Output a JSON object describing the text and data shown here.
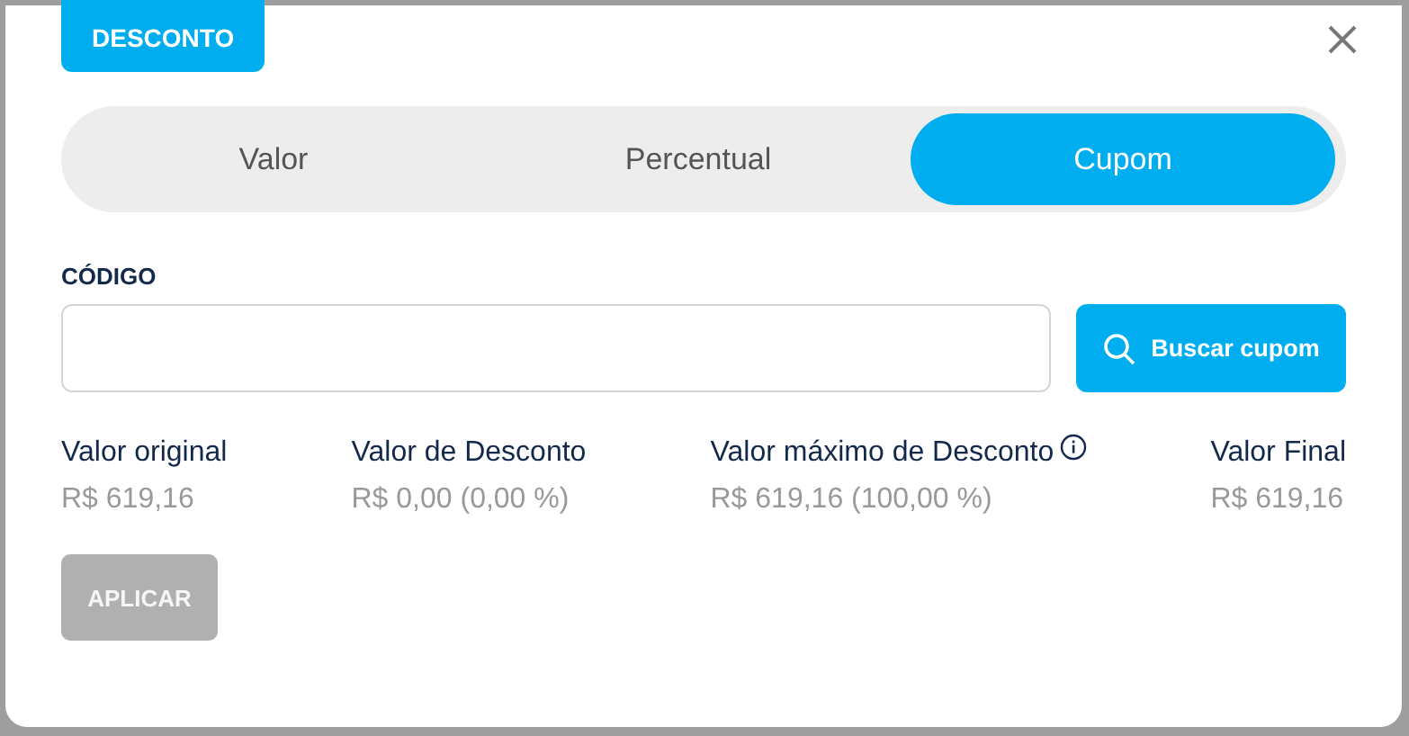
{
  "badge": "DESCONTO",
  "tabs": [
    {
      "label": "Valor",
      "selected": false
    },
    {
      "label": "Percentual",
      "selected": false
    },
    {
      "label": "Cupom",
      "selected": true
    }
  ],
  "code_field": {
    "label": "CÓDIGO"
  },
  "search_button": {
    "label": "Buscar cupom"
  },
  "summary": [
    {
      "label": "Valor original",
      "value": "R$ 619,16",
      "info": false
    },
    {
      "label": "Valor de Desconto",
      "value": "R$ 0,00 (0,00 %)",
      "info": false
    },
    {
      "label": "Valor máximo de Desconto",
      "value": "R$ 619,16 (100,00 %)",
      "info": true
    },
    {
      "label": "Valor Final",
      "value": "R$ 619,16",
      "info": false
    }
  ],
  "apply_button": {
    "label": "APLICAR",
    "disabled": true
  }
}
